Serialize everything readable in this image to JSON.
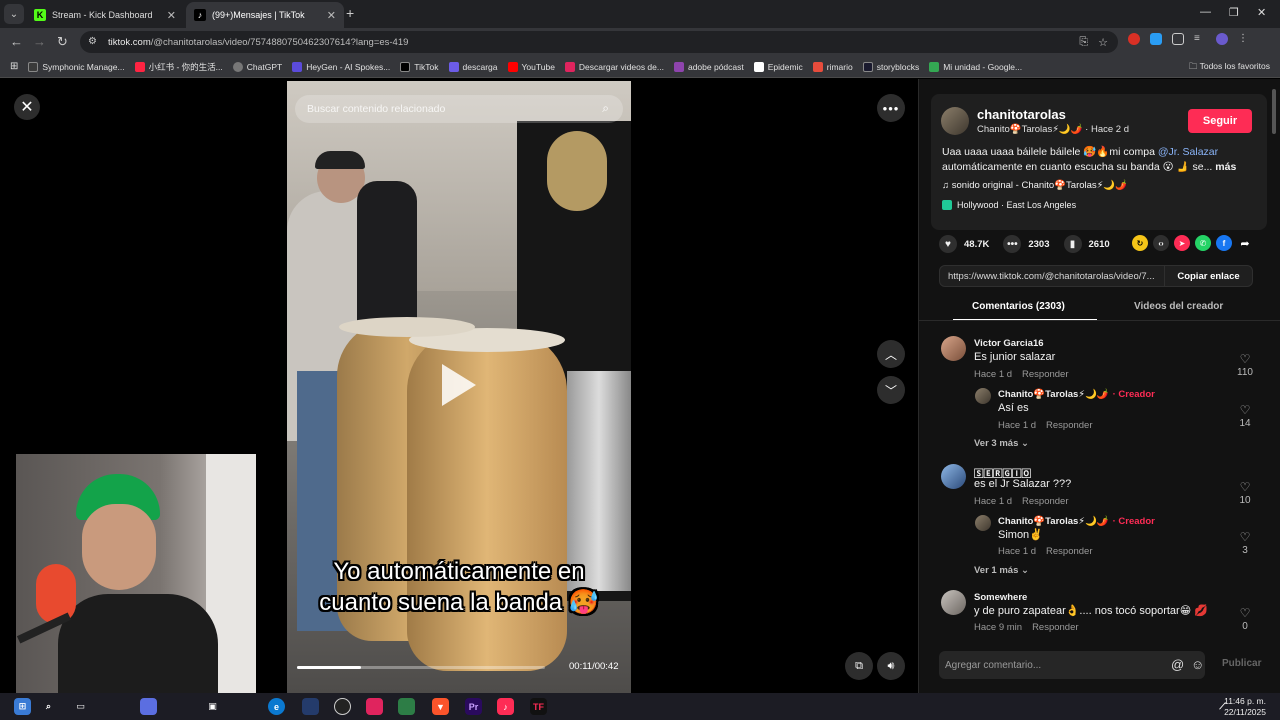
{
  "browser": {
    "tabs": [
      {
        "title": "Stream - Kick Dashboard",
        "favicon_color": "#53fc18",
        "favicon_glyph": "K",
        "active": false
      },
      {
        "title": "(99+)Mensajes | TikTok",
        "favicon_color": "#000000",
        "favicon_glyph": "♪",
        "active": true
      }
    ],
    "url": {
      "host": "tiktok.com",
      "path": "/@chanitotarolas/video/7574880750462307614?lang=es-419"
    },
    "bookmarks": [
      {
        "label": "Symphonic Manage...",
        "color": "#3a3a3a"
      },
      {
        "label": "小红书 - 你的生活...",
        "color": "#ff2442"
      },
      {
        "label": "ChatGPT",
        "color": "#555555"
      },
      {
        "label": "HeyGen - AI Spokes...",
        "color": "#5b4bdb"
      },
      {
        "label": "TikTok",
        "color": "#000000"
      },
      {
        "label": "descarga",
        "color": "#6c5ce7"
      },
      {
        "label": "YouTube",
        "color": "#ff0000"
      },
      {
        "label": "Descargar videos de...",
        "color": "#e0245e"
      },
      {
        "label": "adobe pódcast",
        "color": "#8e44ad"
      },
      {
        "label": "Epidemic",
        "color": "#ffffff"
      },
      {
        "label": "rimario",
        "color": "#e74c3c"
      },
      {
        "label": "storyblocks",
        "color": "#1a1a2e"
      },
      {
        "label": "Mi unidad - Google...",
        "color": "#34a853"
      }
    ],
    "all_bookmarks_label": "Todos los favoritos"
  },
  "video": {
    "search_placeholder": "Buscar contenido relacionado",
    "caption_line1": "Yo automáticamente en",
    "caption_line2": "cuanto suena la banda 🥵",
    "time": "00:11/00:42",
    "progress": 0.26
  },
  "author": {
    "username": "chanitotarolas",
    "display": "Chanito🍄Tarolas⚡🌙🌶️ · Hace 2 d",
    "follow_label": "Seguir"
  },
  "description": {
    "line1": "Uaa uaaa uaaa báilele báilele 🥵🔥mi compa",
    "mention": "@Jr. Salazar",
    "line2": "automáticamente en cuanto escucha su banda 😮 🫸 se...",
    "more": "más",
    "sound": "♫  sonido original - Chanito🍄Tarolas⚡🌙🌶️",
    "location": "Hollywood · East Los Angeles"
  },
  "stats": {
    "likes": "48.7K",
    "comments": "2303",
    "saves": "2610"
  },
  "share": {
    "url": "https://www.tiktok.com/@chanitotarolas/video/7...",
    "copy_label": "Copiar enlace"
  },
  "comment_tabs": {
    "comments": "Comentarios (2303)",
    "creator_videos": "Videos del creador"
  },
  "comments": [
    {
      "name": "Victor Garcia16",
      "text": "Es junior salazar",
      "time": "Hace 1 d",
      "reply": "Responder",
      "likes": "110"
    },
    {
      "name": "Chanito🍄Tarolas⚡🌙🌶️",
      "creator": "· Creador",
      "text": "Así es",
      "time": "Hace 1 d",
      "reply": "Responder",
      "likes": "14"
    },
    {
      "see_more": "Ver 3 más ⌄"
    },
    {
      "name": "🅂🄴🅁🄶🄸🄾",
      "text": "es el Jr Salazar ???",
      "time": "Hace 1 d",
      "reply": "Responder",
      "likes": "10"
    },
    {
      "name": "Chanito🍄Tarolas⚡🌙🌶️",
      "creator": "· Creador",
      "text": "Simon✌️",
      "time": "Hace 1 d",
      "reply": "Responder",
      "likes": "3"
    },
    {
      "see_more": "Ver 1 más ⌄"
    },
    {
      "name": "Somewhere",
      "text": "y de puro zapatear👌.... nos tocó soportar😁 💋",
      "time": "Hace 9 min",
      "reply": "Responder",
      "likes": "0"
    }
  ],
  "compose": {
    "placeholder": "Agregar comentario...",
    "publish": "Publicar"
  },
  "taskbar": {
    "time": "11:46 p. m.",
    "date": "22/11/2025"
  },
  "colors": {
    "accent": "#fe2c55",
    "panel_bg": "#121212",
    "card_bg": "#1f1f1f"
  }
}
